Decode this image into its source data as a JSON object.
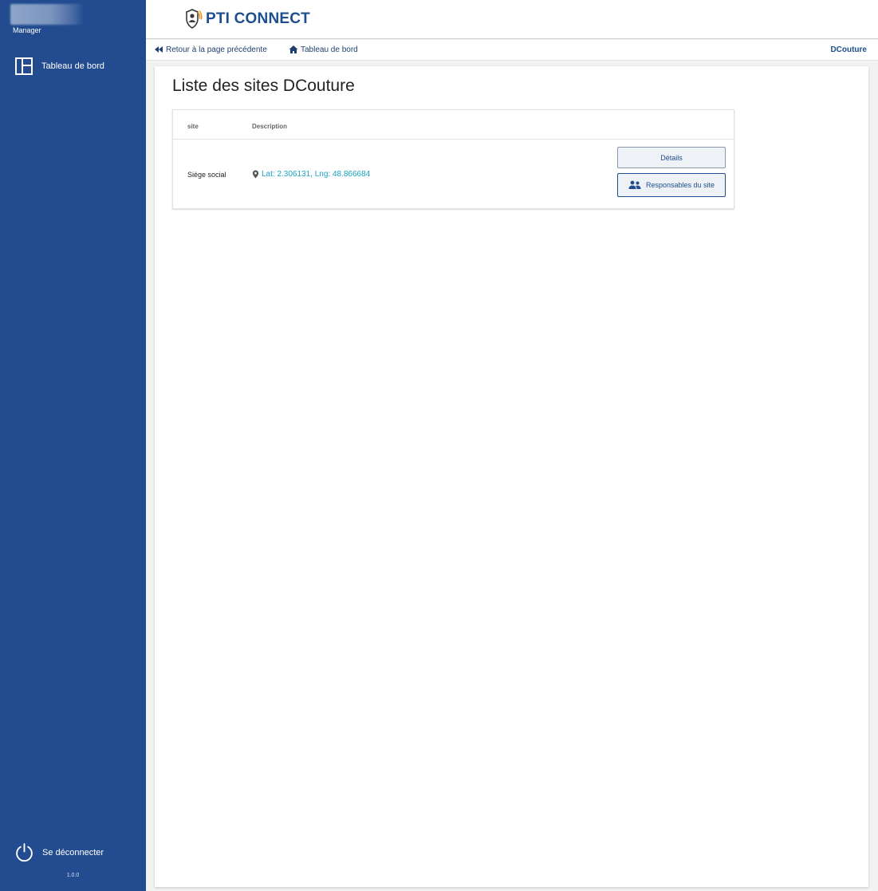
{
  "sidebar": {
    "role": "Manager",
    "nav_items": [
      {
        "label": "Tableau de bord",
        "icon": "dashboard-icon"
      }
    ],
    "logout_label": "Se déconnecter",
    "version": "1.0.0"
  },
  "header": {
    "brand": "PTI CONNECT"
  },
  "breadcrumb": {
    "back_label": "Retour à la page précédente",
    "home_label": "Tableau de bord",
    "company": "DCouture"
  },
  "main": {
    "title": "Liste des sites DCouture",
    "table": {
      "columns": [
        "site",
        "Description"
      ],
      "rows": [
        {
          "site": "Siège social",
          "location": "Lat: 2.306131, Lng: 48.866684",
          "actions": [
            "Détails",
            "Responsables du site"
          ]
        }
      ]
    }
  },
  "colors": {
    "sidebar": "#224c8f",
    "brand": "#1d4f8e",
    "link": "#1aa3c2"
  }
}
